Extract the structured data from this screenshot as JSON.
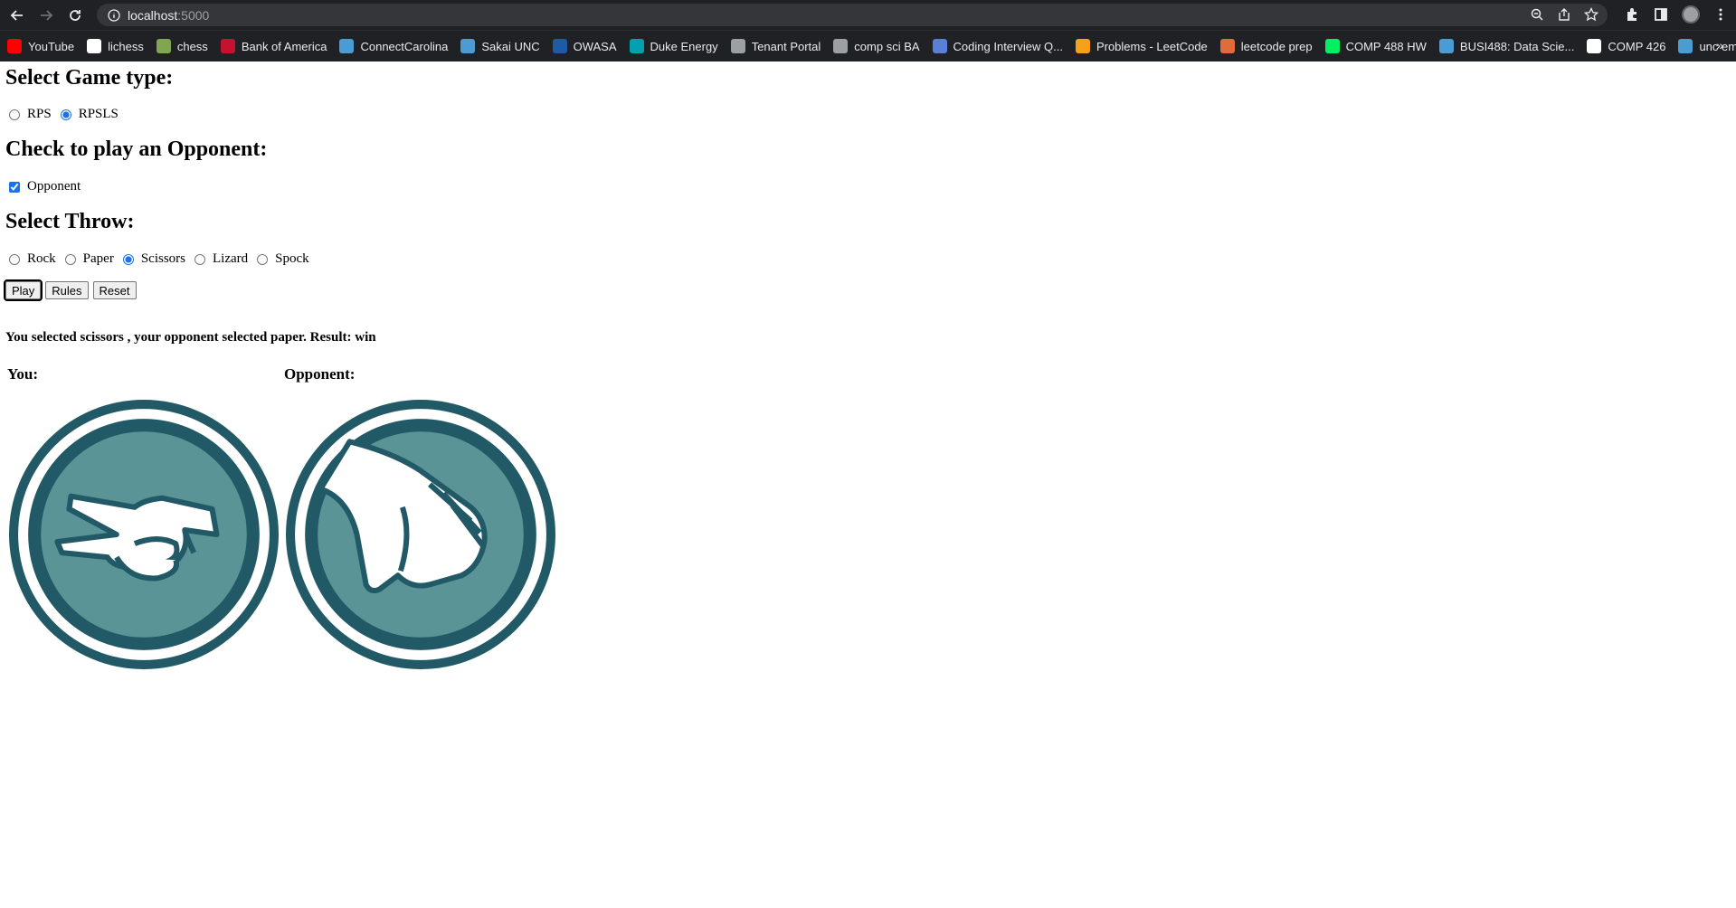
{
  "browser": {
    "url_host": "localhost",
    "url_port": ":5000",
    "bookmarks": [
      {
        "label": "YouTube",
        "color": "#ff0000"
      },
      {
        "label": "lichess",
        "color": "#ffffff"
      },
      {
        "label": "chess",
        "color": "#7fa650"
      },
      {
        "label": "Bank of America",
        "color": "#c41230"
      },
      {
        "label": "ConnectCarolina",
        "color": "#4b9cd3"
      },
      {
        "label": "Sakai UNC",
        "color": "#4b9cd3"
      },
      {
        "label": "OWASA",
        "color": "#1f5aa6"
      },
      {
        "label": "Duke Energy",
        "color": "#00a3ad"
      },
      {
        "label": "Tenant Portal",
        "color": "#9aa0a6"
      },
      {
        "label": "comp sci BA",
        "color": "#9aa0a6"
      },
      {
        "label": "Coding Interview Q...",
        "color": "#5b7fd6"
      },
      {
        "label": "Problems - LeetCode",
        "color": "#f89f1b"
      },
      {
        "label": "leetcode prep",
        "color": "#e06c3c"
      },
      {
        "label": "COMP 488 HW",
        "color": "#03ef62"
      },
      {
        "label": "BUSI488: Data Scie...",
        "color": "#4b9cd3"
      },
      {
        "label": "COMP 426",
        "color": "#ffffff"
      },
      {
        "label": "unc email",
        "color": "#4b9cd3"
      }
    ],
    "more": "»"
  },
  "page": {
    "game_type_heading": "Select Game type:",
    "game_types": [
      {
        "label": "RPS",
        "checked": false
      },
      {
        "label": "RPSLS",
        "checked": true
      }
    ],
    "opponent_heading": "Check to play an Opponent:",
    "opponent_label": "Opponent",
    "opponent_checked": true,
    "throw_heading": "Select Throw:",
    "throws": [
      {
        "label": "Rock",
        "checked": false
      },
      {
        "label": "Paper",
        "checked": false
      },
      {
        "label": "Scissors",
        "checked": true
      },
      {
        "label": "Lizard",
        "checked": false
      },
      {
        "label": "Spock",
        "checked": false
      }
    ],
    "buttons": {
      "play": "Play",
      "rules": "Rules",
      "reset": "Reset"
    },
    "result_text": "You selected scissors , your opponent selected paper. Result: win",
    "you_label": "You:",
    "opponent_display_label": "Opponent:",
    "you_throw": "scissors",
    "opponent_throw": "paper",
    "coin_color": "#215a66",
    "coin_fill": "#5a9496"
  }
}
